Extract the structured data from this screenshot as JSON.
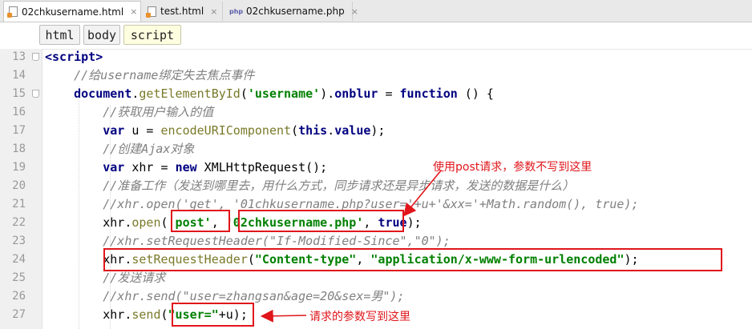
{
  "tabs": [
    {
      "label": "02chkusername.html",
      "icon": "html-file-icon",
      "active": true
    },
    {
      "label": "test.html",
      "icon": "html-file-icon",
      "active": false
    },
    {
      "label": "02chkusername.php",
      "icon": "php-file-icon",
      "active": false
    }
  ],
  "tab_close_glyph": "×",
  "php_icon_text": "php",
  "breadcrumb": [
    "html",
    "body",
    "script"
  ],
  "lines": [
    {
      "num": "13",
      "parts": [
        {
          "t": "<script>",
          "c": "tag"
        }
      ]
    },
    {
      "num": "14",
      "parts": [
        {
          "t": "    //给username绑定失去焦点事件",
          "c": "cm"
        }
      ]
    },
    {
      "num": "15",
      "parts": [
        {
          "t": "    ",
          "c": ""
        },
        {
          "t": "document",
          "c": "kw"
        },
        {
          "t": ".",
          "c": ""
        },
        {
          "t": "getElementById",
          "c": "fn"
        },
        {
          "t": "(",
          "c": ""
        },
        {
          "t": "'username'",
          "c": "str"
        },
        {
          "t": ").",
          "c": ""
        },
        {
          "t": "onblur",
          "c": "kw"
        },
        {
          "t": " = ",
          "c": ""
        },
        {
          "t": "function",
          "c": "kw"
        },
        {
          "t": " () {",
          "c": ""
        }
      ]
    },
    {
      "num": "16",
      "parts": [
        {
          "t": "        //获取用户输入的值",
          "c": "cm"
        }
      ]
    },
    {
      "num": "17",
      "parts": [
        {
          "t": "        ",
          "c": ""
        },
        {
          "t": "var",
          "c": "kw"
        },
        {
          "t": " u = ",
          "c": ""
        },
        {
          "t": "encodeURIComponent",
          "c": "fn"
        },
        {
          "t": "(",
          "c": ""
        },
        {
          "t": "this",
          "c": "kw"
        },
        {
          "t": ".",
          "c": ""
        },
        {
          "t": "value",
          "c": "kw"
        },
        {
          "t": ");",
          "c": ""
        }
      ]
    },
    {
      "num": "18",
      "parts": [
        {
          "t": "        //创建Ajax对象",
          "c": "cm"
        }
      ]
    },
    {
      "num": "19",
      "parts": [
        {
          "t": "        ",
          "c": ""
        },
        {
          "t": "var",
          "c": "kw"
        },
        {
          "t": " xhr = ",
          "c": ""
        },
        {
          "t": "new",
          "c": "kw"
        },
        {
          "t": " XMLHttpRequest();",
          "c": ""
        }
      ]
    },
    {
      "num": "20",
      "parts": [
        {
          "t": "        //准备工作（发送到哪里去，用什么方式，同步请求还是异步请求，发送的数据是什么）",
          "c": "cm"
        }
      ]
    },
    {
      "num": "21",
      "parts": [
        {
          "t": "        //xhr.open('get', '01chkusername.php?user='+u+'&xx='+Math.random(), true);",
          "c": "cm"
        }
      ]
    },
    {
      "num": "22",
      "parts": [
        {
          "t": "        xhr.",
          "c": ""
        },
        {
          "t": "open",
          "c": "fn"
        },
        {
          "t": "(",
          "c": ""
        },
        {
          "t": "'post'",
          "c": "str"
        },
        {
          "t": ", ",
          "c": ""
        },
        {
          "t": "'02chkusername.php'",
          "c": "str"
        },
        {
          "t": ", ",
          "c": ""
        },
        {
          "t": "true",
          "c": "kw"
        },
        {
          "t": ");",
          "c": ""
        }
      ]
    },
    {
      "num": "23",
      "parts": [
        {
          "t": "        //xhr.setRequestHeader(\"If-Modified-Since\",\"0\");",
          "c": "cm"
        }
      ]
    },
    {
      "num": "24",
      "parts": [
        {
          "t": "        xhr.",
          "c": ""
        },
        {
          "t": "setRequestHeader",
          "c": "fn"
        },
        {
          "t": "(",
          "c": ""
        },
        {
          "t": "\"Content-type\"",
          "c": "str"
        },
        {
          "t": ", ",
          "c": ""
        },
        {
          "t": "\"application/x-www-form-urlencoded\"",
          "c": "str"
        },
        {
          "t": ");",
          "c": ""
        }
      ]
    },
    {
      "num": "25",
      "parts": [
        {
          "t": "        //发送请求",
          "c": "cm"
        }
      ]
    },
    {
      "num": "26",
      "parts": [
        {
          "t": "        //xhr.send(\"user=zhangsan&age=20&sex=男\");",
          "c": "cm"
        }
      ]
    },
    {
      "num": "27",
      "parts": [
        {
          "t": "        xhr.",
          "c": ""
        },
        {
          "t": "send",
          "c": "fn"
        },
        {
          "t": "(",
          "c": ""
        },
        {
          "t": "\"user=\"",
          "c": "str"
        },
        {
          "t": "+u);",
          "c": ""
        }
      ]
    }
  ],
  "annotations": {
    "post_note": "使用post请求，参数不写到这里",
    "send_note": "请求的参数写到这里"
  },
  "colors": {
    "annotation": "#e0161b",
    "keyword": "#000080",
    "string": "#008000",
    "comment": "#808080"
  }
}
